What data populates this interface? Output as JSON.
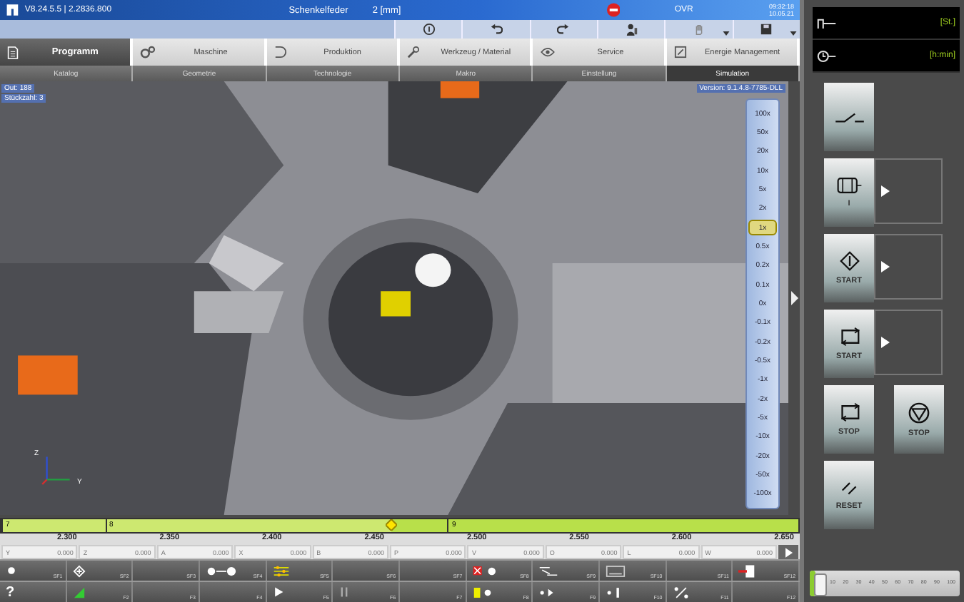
{
  "title_bar": {
    "version": "V8.24.5.5 | 2.2836.800",
    "program": "Schenkelfeder",
    "unit": "2 [mm]",
    "ovr": "OVR",
    "time": "09:32:18",
    "date": "10.05.21"
  },
  "toolbar": [
    {
      "kind": "info",
      "dropdown": false
    },
    {
      "kind": "undo",
      "dropdown": false
    },
    {
      "kind": "redo",
      "dropdown": false
    },
    {
      "kind": "user",
      "dropdown": false
    },
    {
      "kind": "hand",
      "dropdown": true
    },
    {
      "kind": "save",
      "dropdown": true
    }
  ],
  "tabs": [
    {
      "label": "Programm",
      "kind": "doc",
      "selected": true
    },
    {
      "label": "Maschine",
      "kind": "gears",
      "selected": false
    },
    {
      "label": "Produktion",
      "kind": "part",
      "selected": false
    },
    {
      "label": "Werkzeug / Material",
      "kind": "wrench",
      "selected": false
    },
    {
      "label": "Service",
      "kind": "eye",
      "selected": false
    },
    {
      "label": "Energie Management",
      "kind": "meter",
      "selected": false
    }
  ],
  "subtabs": [
    {
      "label": "Katalog",
      "selected": false
    },
    {
      "label": "Geometrie",
      "selected": false
    },
    {
      "label": "Technologie",
      "selected": false
    },
    {
      "label": "Makro",
      "selected": false
    },
    {
      "label": "Einstellung",
      "selected": false
    },
    {
      "label": "Simulation",
      "selected": true
    }
  ],
  "viewport": {
    "info": [
      "Out: 188",
      "Stückzahl: 3"
    ],
    "version": "Version: 9.1.4.8-7785-DLL",
    "axis_labels": [
      "Z",
      "Y"
    ]
  },
  "speed_scale": [
    {
      "label": "100x",
      "selected": false
    },
    {
      "label": "50x",
      "selected": false
    },
    {
      "label": "20x",
      "selected": false
    },
    {
      "label": "10x",
      "selected": false
    },
    {
      "label": "5x",
      "selected": false
    },
    {
      "label": "2x",
      "selected": false
    },
    {
      "label": "1x",
      "selected": true
    },
    {
      "label": "0.5x",
      "selected": false
    },
    {
      "label": "0.2x",
      "selected": false
    },
    {
      "label": "0.1x",
      "selected": false
    },
    {
      "label": "0x",
      "selected": false
    },
    {
      "label": "-0.1x",
      "selected": false
    },
    {
      "label": "-0.2x",
      "selected": false
    },
    {
      "label": "-0.5x",
      "selected": false
    },
    {
      "label": "-1x",
      "selected": false
    },
    {
      "label": "-2x",
      "selected": false
    },
    {
      "label": "-5x",
      "selected": false
    },
    {
      "label": "-10x",
      "selected": false
    },
    {
      "label": "-20x",
      "selected": false
    },
    {
      "label": "-50x",
      "selected": false
    },
    {
      "label": "-100x",
      "selected": false
    }
  ],
  "timeline": {
    "level": 0.49,
    "markers": [
      {
        "label": "7"
      },
      {
        "label": "8"
      },
      {
        "label": "9"
      }
    ],
    "ticks": [
      "2.300",
      "2.350",
      "2.400",
      "2.450",
      "2.500",
      "2.550",
      "2.600",
      "2.650"
    ]
  },
  "axes": [
    {
      "name": "Y",
      "value": "0.000"
    },
    {
      "name": "Z",
      "value": "0.000"
    },
    {
      "name": "A",
      "value": "0.000"
    },
    {
      "name": "X",
      "value": "0.000"
    },
    {
      "name": "B",
      "value": "0.000"
    },
    {
      "name": "P",
      "value": "0.000"
    },
    {
      "name": "V",
      "value": "0.000"
    },
    {
      "name": "O",
      "value": "0.000"
    },
    {
      "name": "L",
      "value": "0.000"
    },
    {
      "name": "W",
      "value": "0.000"
    }
  ],
  "softkeys_top": [
    {
      "label": "SF1",
      "kind": "sun"
    },
    {
      "label": "SF2",
      "kind": "diamond"
    },
    {
      "label": "SF3",
      "kind": "none"
    },
    {
      "label": "SF4",
      "kind": "sun-arrow"
    },
    {
      "label": "SF5",
      "kind": "sliders"
    },
    {
      "label": "SF6",
      "kind": "none"
    },
    {
      "label": "SF7",
      "kind": "none"
    },
    {
      "label": "SF8",
      "kind": "cross"
    },
    {
      "label": "SF9",
      "kind": "nc"
    },
    {
      "label": "SF10",
      "kind": "frame"
    },
    {
      "label": "SF11",
      "kind": "none"
    },
    {
      "label": "SF12",
      "kind": "exit"
    }
  ],
  "softkeys_bottom": [
    {
      "label": "?",
      "kind": "text"
    },
    {
      "label": "F2",
      "kind": "bars"
    },
    {
      "label": "F3",
      "kind": "none"
    },
    {
      "label": "F4",
      "kind": "none"
    },
    {
      "label": "F5",
      "kind": "play"
    },
    {
      "label": "F6",
      "kind": "pause"
    },
    {
      "label": "F7",
      "kind": "none"
    },
    {
      "label": "F8",
      "kind": "battery"
    },
    {
      "label": "F9",
      "kind": "dots"
    },
    {
      "label": "F10",
      "kind": "dotbar"
    },
    {
      "label": "F11",
      "kind": "percent"
    },
    {
      "label": "F12",
      "kind": "none"
    }
  ],
  "counter": [
    {
      "kind": "pieces",
      "unit": "[St.]"
    },
    {
      "kind": "clock",
      "unit": "[h:min]"
    }
  ],
  "control_buttons": [
    {
      "kind": "switch",
      "arrow": false
    },
    {
      "kind": "motor",
      "label": "I",
      "arrow": true
    },
    {
      "kind": "diamond",
      "label": "START",
      "arrow": true
    },
    {
      "kind": "cycle",
      "label": "START",
      "arrow": true
    },
    {
      "kind": "cycle",
      "label": "STOP",
      "arrow": false
    },
    {
      "kind": "triangle",
      "label": "STOP",
      "arrow": false
    },
    {
      "kind": "reset",
      "label": "RESET",
      "arrow": false
    }
  ],
  "override_slider": {
    "level": 0.04,
    "ticks": [
      "10",
      "20",
      "30",
      "40",
      "50",
      "60",
      "70",
      "80",
      "90",
      "100"
    ]
  }
}
